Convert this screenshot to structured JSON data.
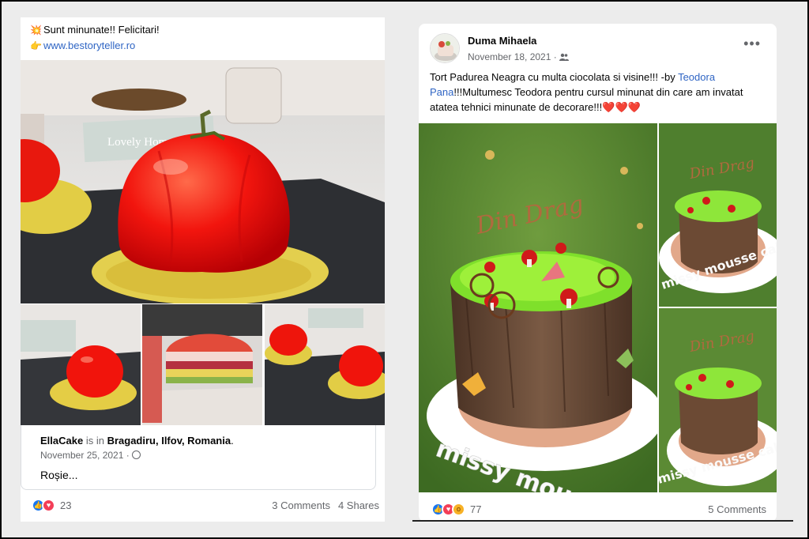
{
  "left_post": {
    "line1": "Sunt minunate!! Felicitari!",
    "line1_emoji": "💥",
    "line2_emoji": "👉",
    "link": "www.bestoryteller.ro",
    "shared": {
      "author": "EllaCake",
      "is_in": "is in",
      "place": "Bragadiru, Ilfov, Romania",
      "period": ".",
      "date": "November 25, 2021 · ",
      "privacy_icon": "globe-icon",
      "caption": "Roșie..."
    },
    "reactions_count": "23",
    "comments": "3 Comments",
    "shares": "4 Shares",
    "photo_sign": "Lovely Home"
  },
  "right_post": {
    "author": "Duma Mihaela",
    "date": "November 18, 2021 · ",
    "privacy_icon": "friends-icon",
    "more": "•••",
    "text_a": "Tort Padurea Neagra cu multa ciocolata si visine!!! -by ",
    "mention": "Teodora Pana",
    "text_b": "!!!Multumesc Teodora pentru cursul minunat din care am invatat atatea tehnici minunate de decorare!!!",
    "hearts": "❤️❤️❤️",
    "reactions_count": "77",
    "comments": "5 Comments",
    "cake_topper": "Din Drag",
    "stand_text": "missy mousse cakes"
  },
  "colors": {
    "link": "#2f65c4",
    "like": "#1877f2",
    "love": "#f33e58",
    "wow": "#f7b125",
    "secondary_text": "#65676b"
  }
}
